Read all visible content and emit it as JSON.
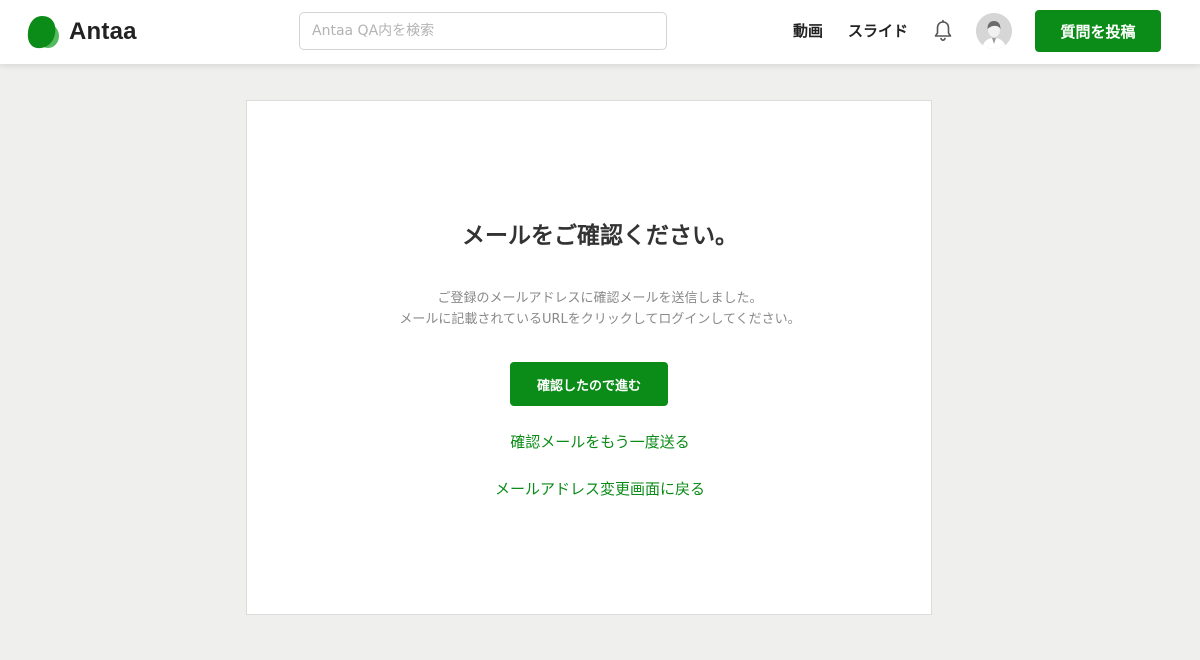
{
  "header": {
    "logo_text": "Antaa",
    "search_placeholder": "Antaa QA内を検索",
    "nav": {
      "video": "動画",
      "slides": "スライド"
    },
    "post_button": "質問を投稿"
  },
  "main": {
    "title": "メールをご確認ください。",
    "description_line1": "ご登録のメールアドレスに確認メールを送信しました。",
    "description_line2": "メールに記載されているURLをクリックしてログインしてください。",
    "confirm_button": "確認したので進む",
    "resend_link": "確認メールをもう一度送る",
    "back_link": "メールアドレス変更画面に戻る"
  },
  "colors": {
    "brand_green": "#0b8b17",
    "page_background": "#eff0ee"
  },
  "icons": {
    "logo": "antaa-logo-icon",
    "notifications": "bell-icon",
    "avatar": "user-avatar"
  }
}
